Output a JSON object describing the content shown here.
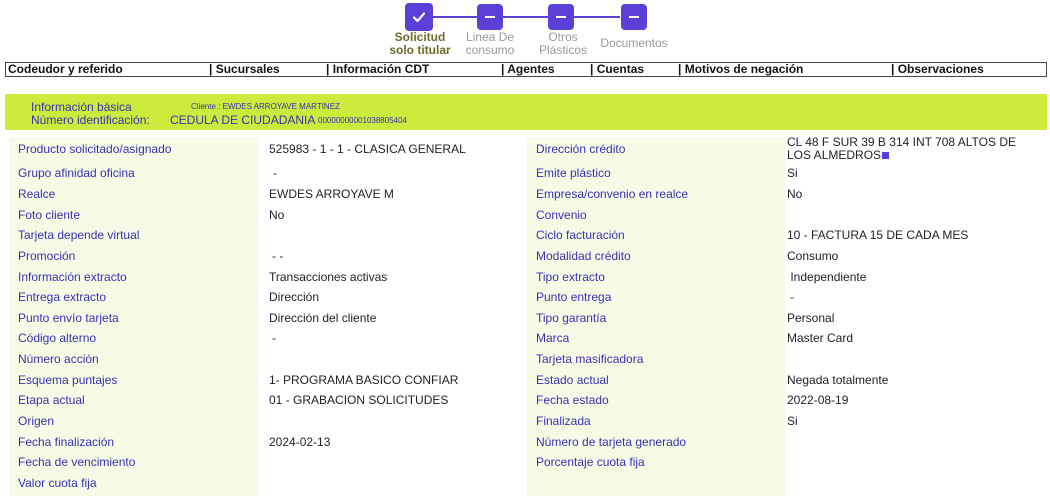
{
  "stepper": {
    "steps": [
      {
        "line1": "Solicitud",
        "line2": "solo titular",
        "state": "done",
        "icon": "check-icon"
      },
      {
        "line1": "Linea De",
        "line2": "consumo",
        "state": "pending",
        "icon": "minus-icon"
      },
      {
        "line1": "Otros",
        "line2": "Plásticos",
        "state": "pending",
        "icon": "minus-icon"
      },
      {
        "line1": "Documentos",
        "line2": "",
        "state": "pending",
        "icon": "minus-icon"
      }
    ]
  },
  "tabs": [
    "Codeudor y referido",
    "| Sucursales",
    "| Información CDT",
    "| Agentes",
    "| Cuentas",
    "| Motivos de negación",
    "| Observaciones"
  ],
  "banner": {
    "basic_info_label": "Información básica",
    "client_text": "Cliente : EWDES ARROYAVE MARTINEZ",
    "id_label": "Número identificación:",
    "id_type": "CEDULA DE CIUDADANIA",
    "id_number": "00000000001038805404"
  },
  "left_rows": [
    {
      "label": "Producto solicitado/asignado",
      "value": "525983 - 1 - 1 - CLASICA GENERAL"
    },
    {
      "label": "Grupo afinidad oficina",
      "value": "-"
    },
    {
      "label": "Realce",
      "value": "EWDES ARROYAVE M"
    },
    {
      "label": "Foto cliente",
      "value": "No"
    },
    {
      "label": "Tarjeta depende virtual",
      "value": ""
    },
    {
      "label": "Promoción",
      "value": "- -"
    },
    {
      "label": "Información extracto",
      "value": "Transacciones activas"
    },
    {
      "label": "Entrega extracto",
      "value": "Dirección"
    },
    {
      "label": "Punto envío tarjeta",
      "value": "Dirección del cliente"
    },
    {
      "label": "Código alterno",
      "value": "-"
    },
    {
      "label": "Número acción",
      "value": ""
    },
    {
      "label": "Esquema puntajes",
      "value": "1- PROGRAMA BASICO CONFIAR"
    },
    {
      "label": "Etapa actual",
      "value": "01 - GRABACION SOLICITUDES"
    },
    {
      "label": "Origen",
      "value": ""
    },
    {
      "label": "Fecha finalización",
      "value": "2024-02-13"
    },
    {
      "label": "Fecha de vencimiento",
      "value": ""
    },
    {
      "label": "Valor cuota fija",
      "value": ""
    }
  ],
  "right_rows": [
    {
      "label": "Dirección crédito",
      "value": "CL 48 F SUR 39 B 314 INT 708 ALTOS DE LOS ALMEDROS"
    },
    {
      "label": "Emite plástico",
      "value": "Si"
    },
    {
      "label": "Empresa/convenio en realce",
      "value": "No"
    },
    {
      "label": "Convenio",
      "value": ""
    },
    {
      "label": "Ciclo facturación",
      "value": "10 - FACTURA 15 DE CADA MES"
    },
    {
      "label": "Modalidad crédito",
      "value": "Consumo"
    },
    {
      "label": "Tipo extracto",
      "value": " Independiente"
    },
    {
      "label": "Punto entrega",
      "value": "-"
    },
    {
      "label": "Tipo garantía",
      "value": "Personal"
    },
    {
      "label": "Marca",
      "value": "Master Card"
    },
    {
      "label": "Tarjeta masificadora",
      "value": ""
    },
    {
      "label": "Estado actual",
      "value": "Negada totalmente"
    },
    {
      "label": "Fecha estado",
      "value": "2022-08-19"
    },
    {
      "label": "Finalizada",
      "value": "Si"
    },
    {
      "label": "Número de tarjeta generado",
      "value": ""
    },
    {
      "label": "Porcentaje cuota fija",
      "value": ""
    }
  ],
  "colors": {
    "accent": "#5b3fd6",
    "banner": "#cdeb3c",
    "label_text": "#3a2fb0",
    "panel_bg": "#f7fbe6"
  }
}
